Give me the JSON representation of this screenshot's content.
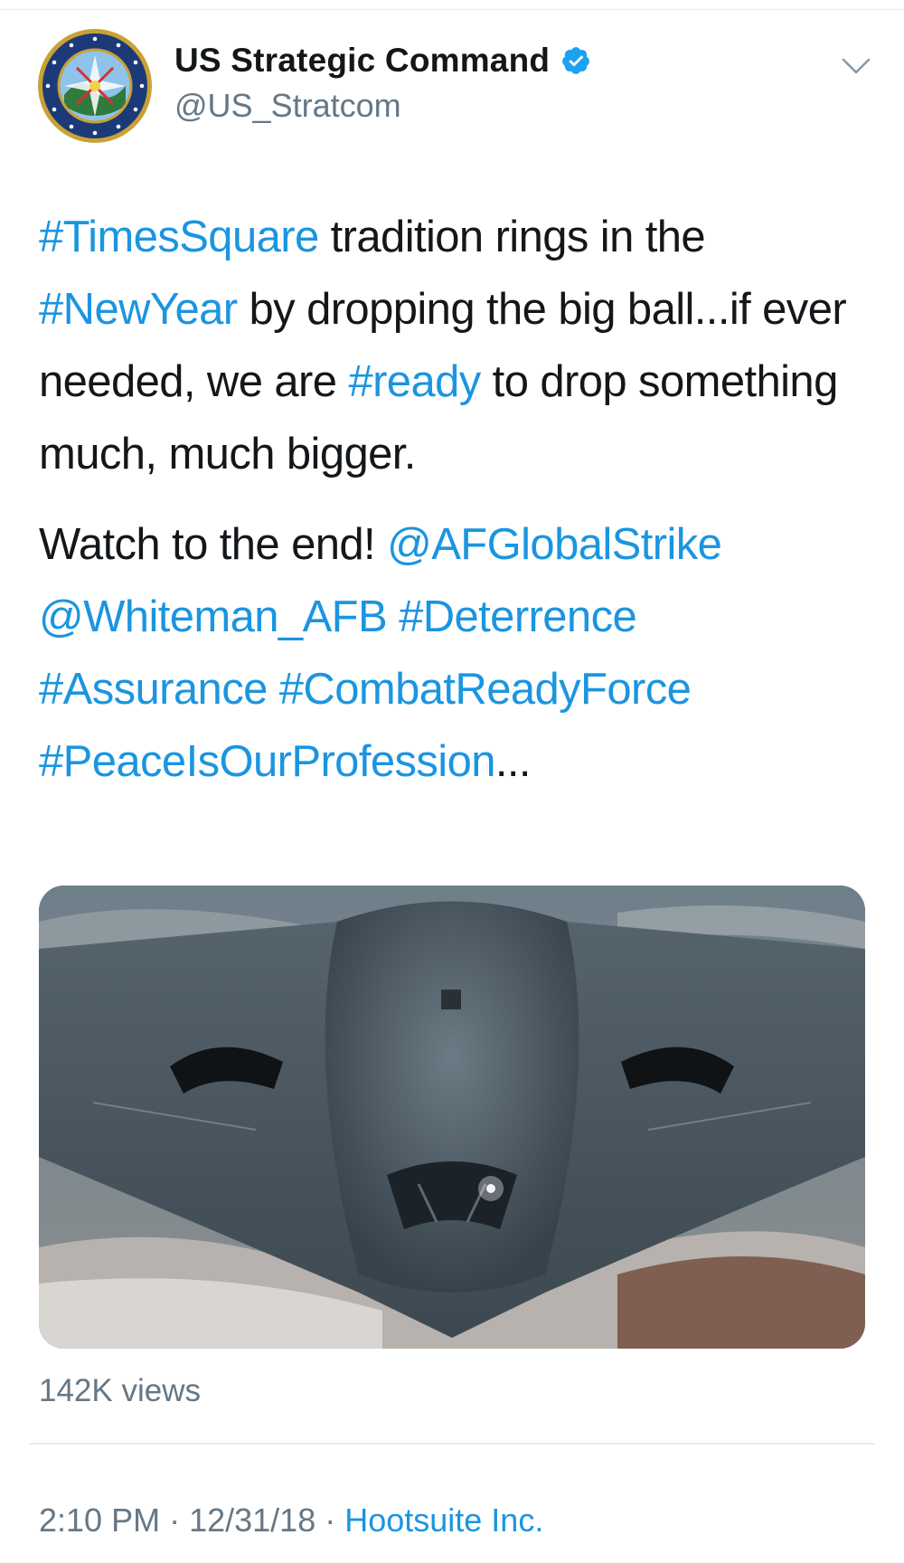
{
  "author": {
    "display_name": "US Strategic Command",
    "handle": "@US_Stratcom",
    "verified": true,
    "avatar_icon": "stratcom-seal-icon",
    "avatar_text": "UNITED STATES STRATEGIC COMMAND"
  },
  "tweet": {
    "paragraph1": [
      {
        "text": "#TimesSquare",
        "type": "hashtag"
      },
      {
        "text": " tradition rings in the ",
        "type": "text"
      },
      {
        "text": "#NewYear",
        "type": "hashtag"
      },
      {
        "text": " by dropping the big ball...if ever needed, we are ",
        "type": "text"
      },
      {
        "text": "#ready",
        "type": "hashtag"
      },
      {
        "text": " to drop something much, much bigger.",
        "type": "text"
      }
    ],
    "paragraph2": [
      {
        "text": "Watch to the end! ",
        "type": "text"
      },
      {
        "text": "@AFGlobalStrike",
        "type": "mention"
      },
      {
        "text": " ",
        "type": "text"
      },
      {
        "text": "@Whiteman_AFB",
        "type": "mention"
      },
      {
        "text": " ",
        "type": "text"
      },
      {
        "text": "#Deterrence",
        "type": "hashtag"
      },
      {
        "text": " ",
        "type": "text"
      },
      {
        "text": "#Assurance",
        "type": "hashtag"
      },
      {
        "text": " ",
        "type": "text"
      },
      {
        "text": "#CombatReadyForce",
        "type": "hashtag"
      },
      {
        "text": " ",
        "type": "text"
      },
      {
        "text": "#PeaceIsOurProfession",
        "type": "hashtag"
      },
      {
        "text": "...",
        "type": "text"
      }
    ]
  },
  "media": {
    "type": "video",
    "icon": "b2-bomber-video-thumbnail"
  },
  "views_label": "142K views",
  "footer": {
    "time": "2:10 PM",
    "separator": " · ",
    "date": "12/31/18",
    "source": "Hootsuite Inc."
  },
  "icons": {
    "verified": "verified-badge-icon",
    "menu": "chevron-down-icon"
  },
  "colors": {
    "link": "#1b95e0",
    "text": "#14171a",
    "secondary": "#657786",
    "divider": "#e6ecf0"
  }
}
